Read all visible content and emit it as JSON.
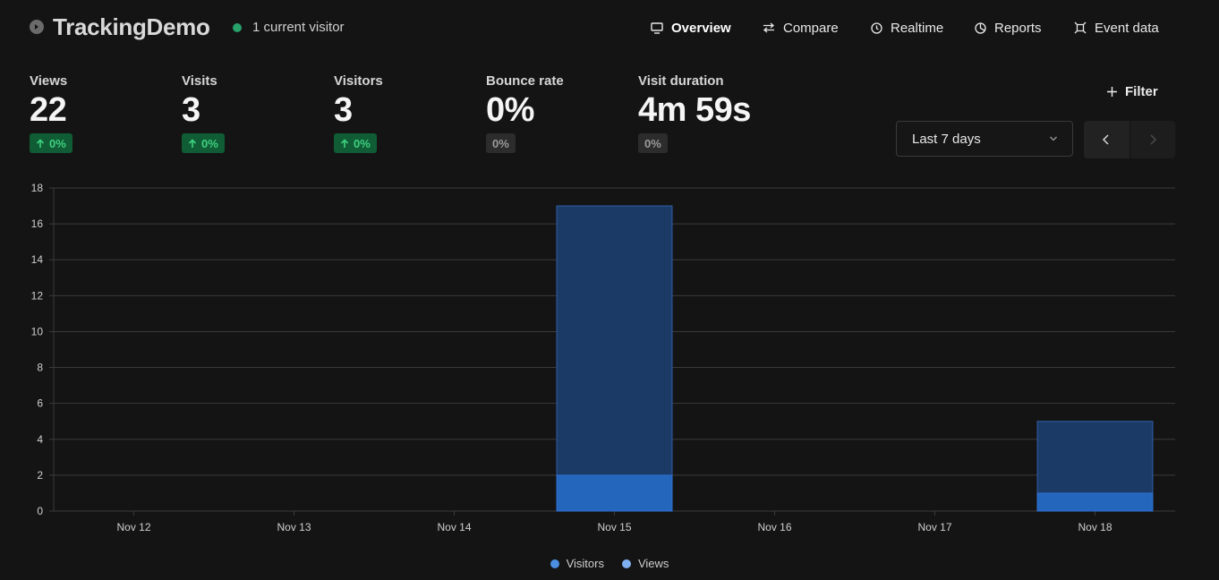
{
  "header": {
    "site_name": "TrackingDemo",
    "live_visitors": "1 current visitor"
  },
  "nav": [
    {
      "label": "Overview",
      "icon": "monitor-icon",
      "active": true
    },
    {
      "label": "Compare",
      "icon": "arrows-swap-icon",
      "active": false
    },
    {
      "label": "Realtime",
      "icon": "clock-icon",
      "active": false
    },
    {
      "label": "Reports",
      "icon": "pie-chart-icon",
      "active": false
    },
    {
      "label": "Event data",
      "icon": "event-icon",
      "active": false
    }
  ],
  "metrics": [
    {
      "label": "Views",
      "value": "22",
      "change": "0%",
      "trend": "up"
    },
    {
      "label": "Visits",
      "value": "3",
      "change": "0%",
      "trend": "up"
    },
    {
      "label": "Visitors",
      "value": "3",
      "change": "0%",
      "trend": "up"
    },
    {
      "label": "Bounce rate",
      "value": "0%",
      "change": "0%",
      "trend": "flat"
    },
    {
      "label": "Visit duration",
      "value": "4m 59s",
      "change": "0%",
      "trend": "flat"
    }
  ],
  "controls": {
    "filter_label": "Filter",
    "date_range": "Last 7 days"
  },
  "colors": {
    "background": "#141414",
    "positive": "#3fd17f",
    "visitors_bar": "#2566bd",
    "views_bar": "#1c3a66",
    "legend_visitors": "#4a8fe2",
    "legend_views": "#7fb0ef"
  },
  "chart_data": {
    "type": "bar",
    "stacked": true,
    "categories": [
      "Nov 12",
      "Nov 13",
      "Nov 14",
      "Nov 15",
      "Nov 16",
      "Nov 17",
      "Nov 18"
    ],
    "series": [
      {
        "name": "Visitors",
        "values": [
          0,
          0,
          0,
          2,
          0,
          0,
          1
        ]
      },
      {
        "name": "Views",
        "values": [
          0,
          0,
          0,
          17,
          0,
          0,
          5
        ]
      }
    ],
    "ylim": [
      0,
      18
    ],
    "yticks": [
      0,
      2,
      4,
      6,
      8,
      10,
      12,
      14,
      16,
      18
    ],
    "grid": true,
    "legend": "bottom-center"
  }
}
